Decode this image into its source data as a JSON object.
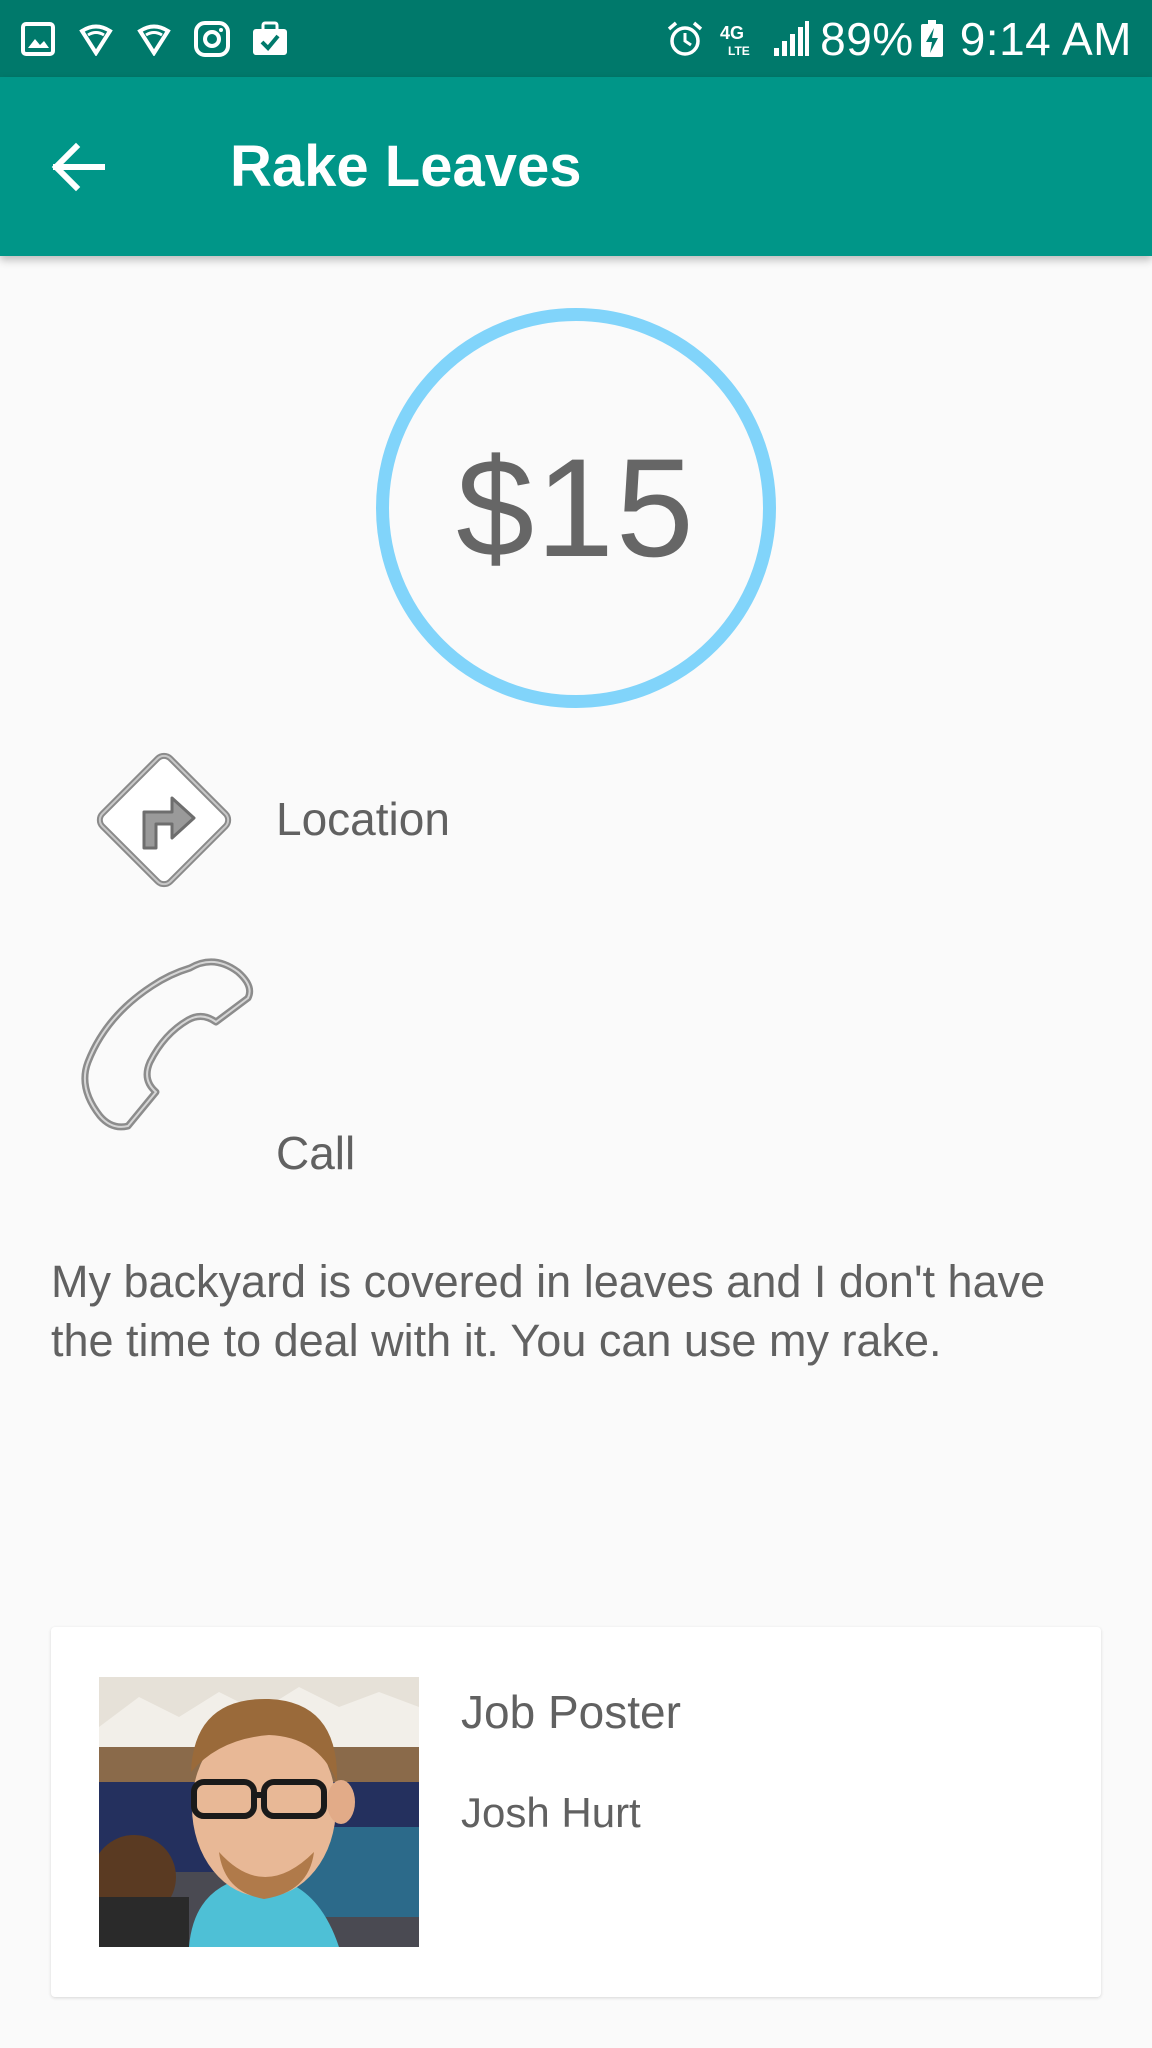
{
  "status_bar": {
    "left_icons": [
      "gallery-icon",
      "shield-icon",
      "shield-icon",
      "instagram-icon",
      "briefcase-check-icon"
    ],
    "right_icons": [
      "alarm-icon",
      "4g-lte-icon",
      "signal-icon",
      "battery-charging-icon"
    ],
    "network": "4G LTE",
    "battery": "89%",
    "time": "9:14 AM"
  },
  "app_bar": {
    "title": "Rake Leaves",
    "back_icon": "arrow-back-icon"
  },
  "job": {
    "price": "$15",
    "location_label": "Location",
    "location_icon": "turn-right-sign-icon",
    "call_label": "Call",
    "call_icon": "phone-handset-icon",
    "description": "My backyard is covered in leaves and I don't have the time to deal with it. You can use my rake."
  },
  "poster": {
    "label": "Job Poster",
    "name": "Josh Hurt"
  },
  "colors": {
    "status_bar": "#00796b",
    "app_bar": "#009688",
    "price_ring": "#81d4fa",
    "text": "#616161",
    "background": "#fafafa"
  }
}
